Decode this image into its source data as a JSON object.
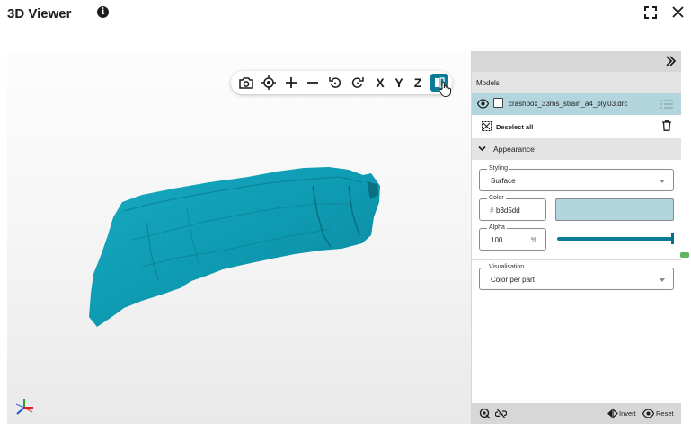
{
  "window": {
    "title": "3D Viewer",
    "info_icon": "info-icon",
    "fullscreen_icon": "fullscreen-icon",
    "close_icon": "close-icon"
  },
  "toolbar": {
    "buttons": [
      {
        "name": "screenshot",
        "icon": "camera-icon"
      },
      {
        "name": "center",
        "icon": "target-icon"
      },
      {
        "name": "zoom-in",
        "icon": "plus-icon"
      },
      {
        "name": "zoom-out",
        "icon": "minus-icon"
      },
      {
        "name": "rotate-left",
        "icon": "rotate-left-icon"
      },
      {
        "name": "rotate-right",
        "icon": "rotate-right-icon"
      },
      {
        "name": "view-x",
        "label": "X"
      },
      {
        "name": "view-y",
        "label": "Y"
      },
      {
        "name": "view-z",
        "label": "Z"
      },
      {
        "name": "section",
        "icon": "section-icon",
        "active": true
      }
    ]
  },
  "model": {
    "color": "#0e9bb2"
  },
  "panel": {
    "models_header": "Models",
    "model_name": "crashbox_33ms_strain_a4_ply.03.drc",
    "deselect_all": "Deselect all",
    "appearance_header": "Appearance",
    "styling": {
      "legend": "Styling",
      "value": "Surface"
    },
    "color": {
      "legend": "Color",
      "hash": "#",
      "value": "b3d5dd",
      "swatch": "#b3d5dd"
    },
    "alpha": {
      "legend": "Alpha",
      "value": "100",
      "unit": "%",
      "level": 1.0
    },
    "visualisation": {
      "legend": "Visualisation",
      "value": "Color per part"
    },
    "footer": {
      "invert_label": "Invert",
      "reset_label": "Reset"
    }
  },
  "colors": {
    "accent": "#0c7c96",
    "selected_row": "#b3d5dd",
    "header_bg": "#e4e4e4"
  }
}
